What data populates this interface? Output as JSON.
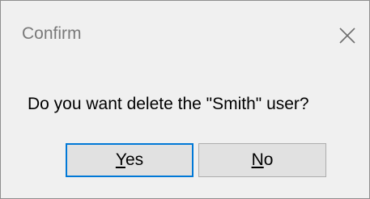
{
  "dialog": {
    "title": "Confirm",
    "message": "Do you want delete the \"Smith\" user?",
    "buttons": {
      "yes": {
        "mnemonic": "Y",
        "rest": "es"
      },
      "no": {
        "mnemonic": "N",
        "rest": "o"
      }
    },
    "close_icon": "close-icon"
  },
  "colors": {
    "background": "#f0f0f0",
    "title_text": "#7a7a7a",
    "button_face": "#e1e1e1",
    "default_button_border": "#0078d7"
  }
}
